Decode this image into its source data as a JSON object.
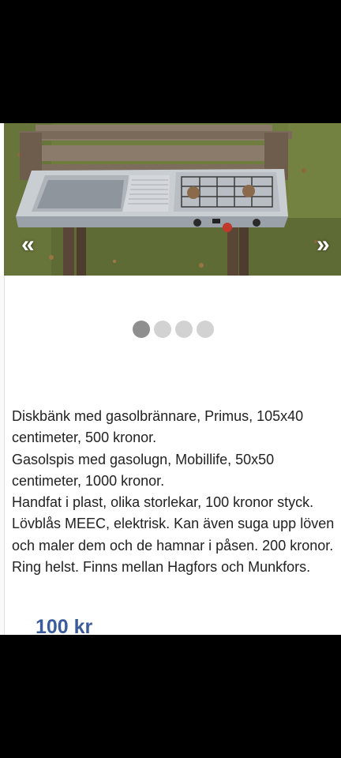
{
  "gallery": {
    "prev_label": "«",
    "next_label": "»",
    "dots": [
      {
        "active": true
      },
      {
        "active": false
      },
      {
        "active": false
      },
      {
        "active": false
      }
    ]
  },
  "listing": {
    "description_lines": [
      "Diskbänk med gasolbrännare, Primus, 105x40 centimeter, 500 kronor.",
      "Gasolspis med gasolugn, Mobillife, 50x50 centimeter, 1000 kronor.",
      "Handfat i plast, olika storlekar, 100 kronor styck.",
      "Lövblås MEEC, elektrisk. Kan även suga upp löven och maler dem och de hamnar i påsen. 200 kronor.",
      "Ring helst. Finns mellan Hagfors och Munkfors."
    ],
    "price": "100 kr"
  },
  "colors": {
    "price": "#3b5b9b",
    "dot_active": "#8f8f8f",
    "dot_inactive": "#d2d2d2"
  }
}
